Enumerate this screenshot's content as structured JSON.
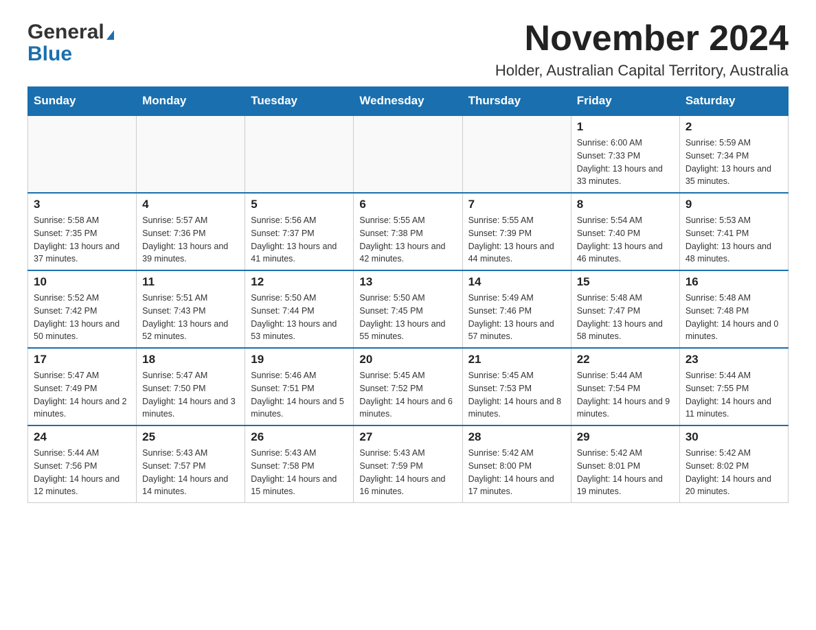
{
  "logo": {
    "general": "General",
    "blue": "Blue"
  },
  "title": "November 2024",
  "location": "Holder, Australian Capital Territory, Australia",
  "days_of_week": [
    "Sunday",
    "Monday",
    "Tuesday",
    "Wednesday",
    "Thursday",
    "Friday",
    "Saturday"
  ],
  "weeks": [
    [
      {
        "day": "",
        "sunrise": "",
        "sunset": "",
        "daylight": ""
      },
      {
        "day": "",
        "sunrise": "",
        "sunset": "",
        "daylight": ""
      },
      {
        "day": "",
        "sunrise": "",
        "sunset": "",
        "daylight": ""
      },
      {
        "day": "",
        "sunrise": "",
        "sunset": "",
        "daylight": ""
      },
      {
        "day": "",
        "sunrise": "",
        "sunset": "",
        "daylight": ""
      },
      {
        "day": "1",
        "sunrise": "Sunrise: 6:00 AM",
        "sunset": "Sunset: 7:33 PM",
        "daylight": "Daylight: 13 hours and 33 minutes."
      },
      {
        "day": "2",
        "sunrise": "Sunrise: 5:59 AM",
        "sunset": "Sunset: 7:34 PM",
        "daylight": "Daylight: 13 hours and 35 minutes."
      }
    ],
    [
      {
        "day": "3",
        "sunrise": "Sunrise: 5:58 AM",
        "sunset": "Sunset: 7:35 PM",
        "daylight": "Daylight: 13 hours and 37 minutes."
      },
      {
        "day": "4",
        "sunrise": "Sunrise: 5:57 AM",
        "sunset": "Sunset: 7:36 PM",
        "daylight": "Daylight: 13 hours and 39 minutes."
      },
      {
        "day": "5",
        "sunrise": "Sunrise: 5:56 AM",
        "sunset": "Sunset: 7:37 PM",
        "daylight": "Daylight: 13 hours and 41 minutes."
      },
      {
        "day": "6",
        "sunrise": "Sunrise: 5:55 AM",
        "sunset": "Sunset: 7:38 PM",
        "daylight": "Daylight: 13 hours and 42 minutes."
      },
      {
        "day": "7",
        "sunrise": "Sunrise: 5:55 AM",
        "sunset": "Sunset: 7:39 PM",
        "daylight": "Daylight: 13 hours and 44 minutes."
      },
      {
        "day": "8",
        "sunrise": "Sunrise: 5:54 AM",
        "sunset": "Sunset: 7:40 PM",
        "daylight": "Daylight: 13 hours and 46 minutes."
      },
      {
        "day": "9",
        "sunrise": "Sunrise: 5:53 AM",
        "sunset": "Sunset: 7:41 PM",
        "daylight": "Daylight: 13 hours and 48 minutes."
      }
    ],
    [
      {
        "day": "10",
        "sunrise": "Sunrise: 5:52 AM",
        "sunset": "Sunset: 7:42 PM",
        "daylight": "Daylight: 13 hours and 50 minutes."
      },
      {
        "day": "11",
        "sunrise": "Sunrise: 5:51 AM",
        "sunset": "Sunset: 7:43 PM",
        "daylight": "Daylight: 13 hours and 52 minutes."
      },
      {
        "day": "12",
        "sunrise": "Sunrise: 5:50 AM",
        "sunset": "Sunset: 7:44 PM",
        "daylight": "Daylight: 13 hours and 53 minutes."
      },
      {
        "day": "13",
        "sunrise": "Sunrise: 5:50 AM",
        "sunset": "Sunset: 7:45 PM",
        "daylight": "Daylight: 13 hours and 55 minutes."
      },
      {
        "day": "14",
        "sunrise": "Sunrise: 5:49 AM",
        "sunset": "Sunset: 7:46 PM",
        "daylight": "Daylight: 13 hours and 57 minutes."
      },
      {
        "day": "15",
        "sunrise": "Sunrise: 5:48 AM",
        "sunset": "Sunset: 7:47 PM",
        "daylight": "Daylight: 13 hours and 58 minutes."
      },
      {
        "day": "16",
        "sunrise": "Sunrise: 5:48 AM",
        "sunset": "Sunset: 7:48 PM",
        "daylight": "Daylight: 14 hours and 0 minutes."
      }
    ],
    [
      {
        "day": "17",
        "sunrise": "Sunrise: 5:47 AM",
        "sunset": "Sunset: 7:49 PM",
        "daylight": "Daylight: 14 hours and 2 minutes."
      },
      {
        "day": "18",
        "sunrise": "Sunrise: 5:47 AM",
        "sunset": "Sunset: 7:50 PM",
        "daylight": "Daylight: 14 hours and 3 minutes."
      },
      {
        "day": "19",
        "sunrise": "Sunrise: 5:46 AM",
        "sunset": "Sunset: 7:51 PM",
        "daylight": "Daylight: 14 hours and 5 minutes."
      },
      {
        "day": "20",
        "sunrise": "Sunrise: 5:45 AM",
        "sunset": "Sunset: 7:52 PM",
        "daylight": "Daylight: 14 hours and 6 minutes."
      },
      {
        "day": "21",
        "sunrise": "Sunrise: 5:45 AM",
        "sunset": "Sunset: 7:53 PM",
        "daylight": "Daylight: 14 hours and 8 minutes."
      },
      {
        "day": "22",
        "sunrise": "Sunrise: 5:44 AM",
        "sunset": "Sunset: 7:54 PM",
        "daylight": "Daylight: 14 hours and 9 minutes."
      },
      {
        "day": "23",
        "sunrise": "Sunrise: 5:44 AM",
        "sunset": "Sunset: 7:55 PM",
        "daylight": "Daylight: 14 hours and 11 minutes."
      }
    ],
    [
      {
        "day": "24",
        "sunrise": "Sunrise: 5:44 AM",
        "sunset": "Sunset: 7:56 PM",
        "daylight": "Daylight: 14 hours and 12 minutes."
      },
      {
        "day": "25",
        "sunrise": "Sunrise: 5:43 AM",
        "sunset": "Sunset: 7:57 PM",
        "daylight": "Daylight: 14 hours and 14 minutes."
      },
      {
        "day": "26",
        "sunrise": "Sunrise: 5:43 AM",
        "sunset": "Sunset: 7:58 PM",
        "daylight": "Daylight: 14 hours and 15 minutes."
      },
      {
        "day": "27",
        "sunrise": "Sunrise: 5:43 AM",
        "sunset": "Sunset: 7:59 PM",
        "daylight": "Daylight: 14 hours and 16 minutes."
      },
      {
        "day": "28",
        "sunrise": "Sunrise: 5:42 AM",
        "sunset": "Sunset: 8:00 PM",
        "daylight": "Daylight: 14 hours and 17 minutes."
      },
      {
        "day": "29",
        "sunrise": "Sunrise: 5:42 AM",
        "sunset": "Sunset: 8:01 PM",
        "daylight": "Daylight: 14 hours and 19 minutes."
      },
      {
        "day": "30",
        "sunrise": "Sunrise: 5:42 AM",
        "sunset": "Sunset: 8:02 PM",
        "daylight": "Daylight: 14 hours and 20 minutes."
      }
    ]
  ]
}
